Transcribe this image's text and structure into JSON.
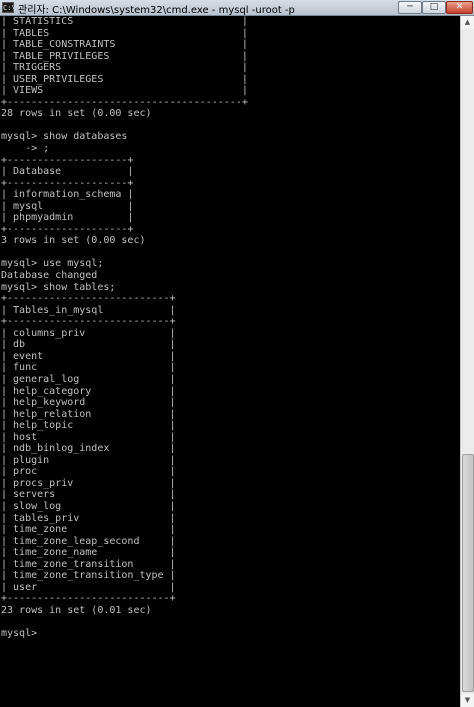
{
  "window": {
    "title": "관리자: C:\\Windows\\system32\\cmd.exe - mysql  -uroot -p",
    "icon_label": "C:\\",
    "minimize_label": "─",
    "maximize_label": "□",
    "close_label": "✕"
  },
  "console": {
    "text": "| STATISTICS                            |\n| TABLES                                |\n| TABLE_CONSTRAINTS                     |\n| TABLE_PRIVILEGES                      |\n| TRIGGERS                              |\n| USER_PRIVILEGES                       |\n| VIEWS                                 |\n+---------------------------------------+\n28 rows in set (0.00 sec)\n\nmysql> show databases\n    -> ;\n+--------------------+\n| Database           |\n+--------------------+\n| information_schema |\n| mysql              |\n| phpmyadmin         |\n+--------------------+\n3 rows in set (0.00 sec)\n\nmysql> use mysql;\nDatabase changed\nmysql> show tables;\n+---------------------------+\n| Tables_in_mysql           |\n+---------------------------+\n| columns_priv              |\n| db                        |\n| event                     |\n| func                      |\n| general_log               |\n| help_category             |\n| help_keyword              |\n| help_relation             |\n| help_topic                |\n| host                      |\n| ndb_binlog_index          |\n| plugin                    |\n| proc                      |\n| procs_priv                |\n| servers                   |\n| slow_log                  |\n| tables_priv               |\n| time_zone                 |\n| time_zone_leap_second     |\n| time_zone_name            |\n| time_zone_transition      |\n| time_zone_transition_type |\n| user                      |\n+---------------------------+\n23 rows in set (0.01 sec)\n\nmysql>"
  },
  "scrollbar": {
    "up_arrow": "▲",
    "down_arrow": "▼"
  }
}
